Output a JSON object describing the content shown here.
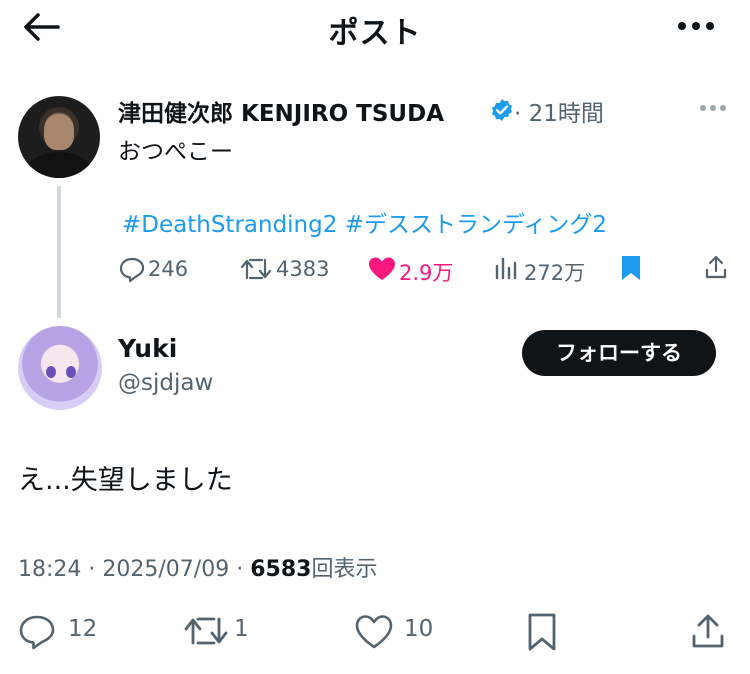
{
  "header": {
    "title": "ポスト"
  },
  "parent_post": {
    "author_name": "津田健次郎 KENJIRO TSUDA",
    "time_sep": "·",
    "time": "21時間",
    "text": "おつぺこー",
    "hashtag1": "#DeathStranding2",
    "hashtag2": "#デスストランディング2",
    "replies": "246",
    "reposts": "4383",
    "likes": "2.9万",
    "views": "272万"
  },
  "reply_post": {
    "author_name": "Yuki",
    "handle": "@sjdjaw",
    "follow_label": "フォローする",
    "text": "え...失望しました",
    "time": "18:24",
    "sep1": "·",
    "date": "2025/07/09",
    "sep2": "·",
    "views_count": "6583",
    "views_label": "回表示",
    "replies": "12",
    "reposts": "1",
    "likes": "10"
  },
  "colors": {
    "accent": "#1d9bf0",
    "like": "#f91880",
    "muted": "#536471",
    "text": "#0f1419"
  }
}
